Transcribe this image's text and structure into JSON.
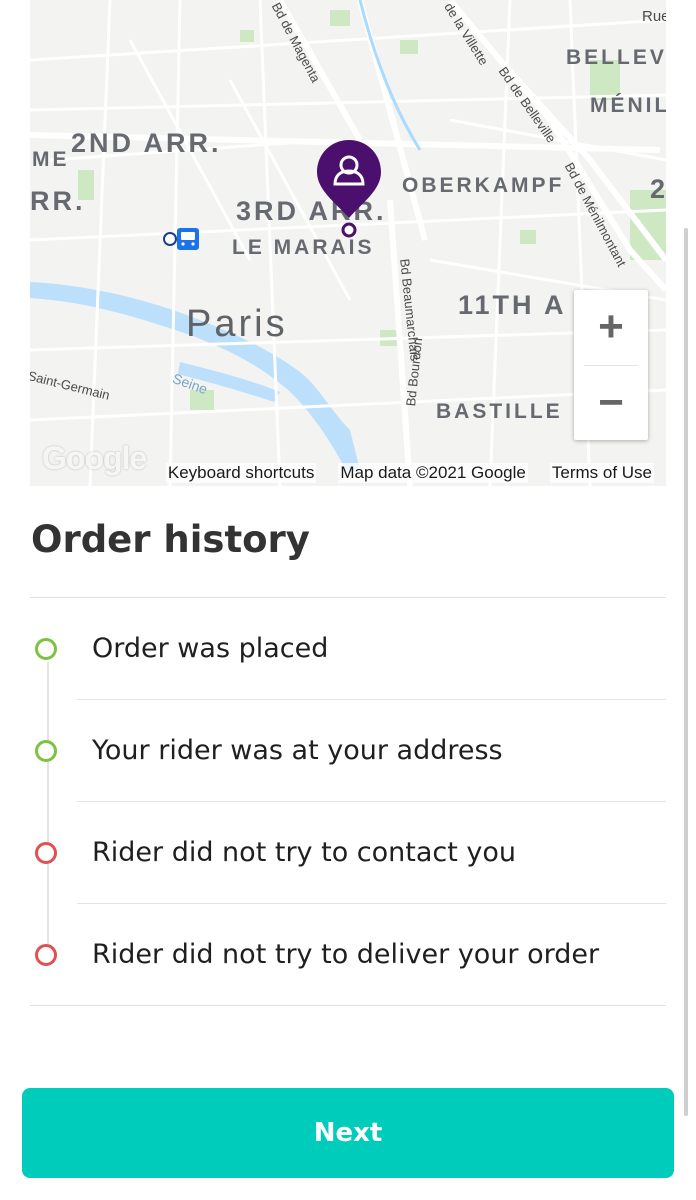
{
  "map": {
    "labels": {
      "second_arr": "2ND ARR.",
      "third_arr": "3RD ARR.",
      "le_marais": "LE MARAIS",
      "oberkampf": "OBERKAMPF",
      "belleville": "BELLEV",
      "menilmontant": "MÉNIL",
      "eleventh": "11TH A",
      "bastille": "BASTILLE",
      "city": "Paris",
      "left_arr": "RR.",
      "left_me": "ME",
      "right_2": "2",
      "top_rue": "Rue"
    },
    "streets": {
      "magenta": "Bd de Magenta",
      "villette": "de la Villette",
      "belleville_bd": "Bd de Belleville",
      "menilmontant_bd": "Bd de Ménilmontant",
      "beaumarchais": "Bd Beaumarchais",
      "bourdon": "Bd Bourdon",
      "saint_germain": "Saint-Germain",
      "seine": "Seine"
    },
    "google_logo": "Google",
    "attribution": {
      "shortcuts": "Keyboard shortcuts",
      "map_data": "Map data ©2021 Google",
      "terms": "Terms of Use"
    },
    "zoom_in": "+",
    "zoom_out": "−"
  },
  "order_history": {
    "title": "Order history",
    "events": [
      {
        "label": "Order was placed",
        "status": "done"
      },
      {
        "label": "Your rider was at your address",
        "status": "done"
      },
      {
        "label": "Rider did not try to contact you",
        "status": "failed"
      },
      {
        "label": "Rider did not try to deliver your order",
        "status": "failed"
      }
    ]
  },
  "actions": {
    "next_label": "Next"
  },
  "colors": {
    "done": "#7dc242",
    "failed": "#e05252",
    "accent": "#00ccbc",
    "pin": "#4b0f6e"
  }
}
